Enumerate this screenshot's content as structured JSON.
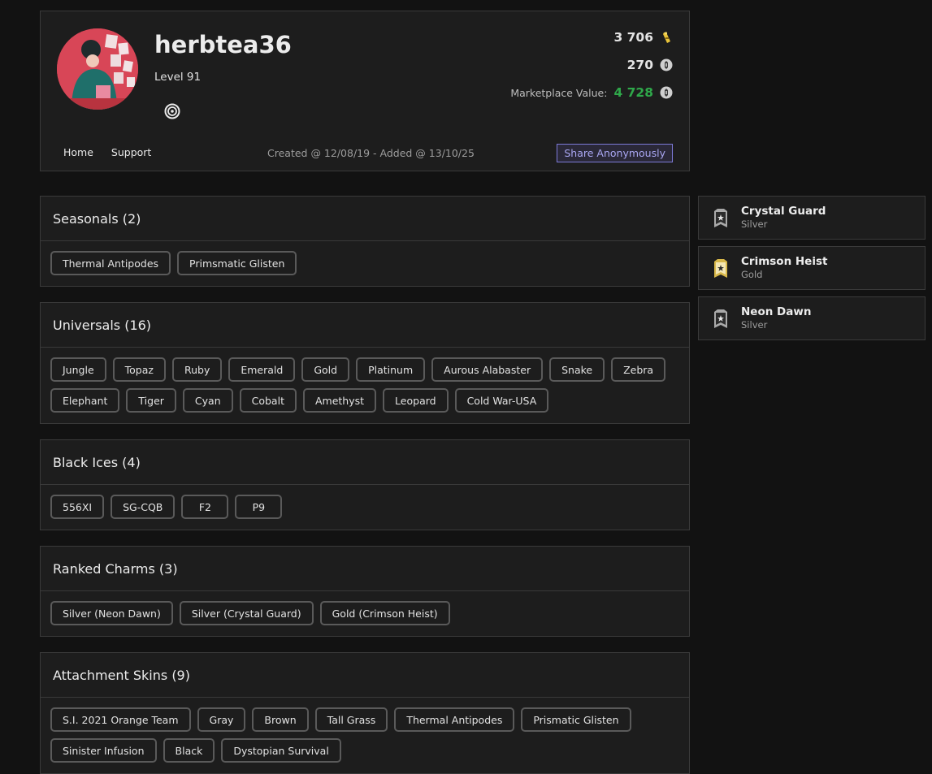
{
  "profile": {
    "username": "herbtea36",
    "level": "Level 91",
    "credits": "3 706",
    "renown": "270",
    "marketplace_label": "Marketplace Value:",
    "marketplace_value": "4 728",
    "created": "Created @ 12/08/19 - Added @ 13/10/25",
    "share_label": "Share Anonymously",
    "avatar_icon": "avatar-image",
    "platform_icon": "ubisoft-swirl-icon"
  },
  "nav": [
    "Home",
    "Support"
  ],
  "colors": {
    "accent": "#7d7ad8",
    "marketplace_value": "#2fa84a",
    "credit_coin": "#e9c43a"
  },
  "sections": [
    {
      "title": "Seasonals (2)",
      "tags": [
        "Thermal Antipodes",
        "Primsmatic Glisten"
      ]
    },
    {
      "title": "Universals (16)",
      "tags": [
        "Jungle",
        "Topaz",
        "Ruby",
        "Emerald",
        "Gold",
        "Platinum",
        "Aurous Alabaster",
        "Snake",
        "Zebra",
        "Elephant",
        "Tiger",
        "Cyan",
        "Cobalt",
        "Amethyst",
        "Leopard",
        "Cold War-USA"
      ]
    },
    {
      "title": "Black Ices (4)",
      "tags": [
        "556XI",
        "SG-CQB",
        "F2",
        "P9"
      ]
    },
    {
      "title": "Ranked Charms (3)",
      "tags": [
        "Silver (Neon Dawn)",
        "Silver (Crystal Guard)",
        "Gold (Crimson Heist)"
      ]
    },
    {
      "title": "Attachment Skins (9)",
      "tags": [
        "S.I. 2021 Orange Team",
        "Gray",
        "Brown",
        "Tall Grass",
        "Thermal Antipodes",
        "Prismatic Glisten",
        "Sinister Infusion",
        "Black",
        "Dystopian Survival"
      ]
    }
  ],
  "charms": [
    {
      "name": "Crystal Guard",
      "rank": "Silver"
    },
    {
      "name": "Crimson Heist",
      "rank": "Gold"
    },
    {
      "name": "Neon Dawn",
      "rank": "Silver"
    }
  ]
}
